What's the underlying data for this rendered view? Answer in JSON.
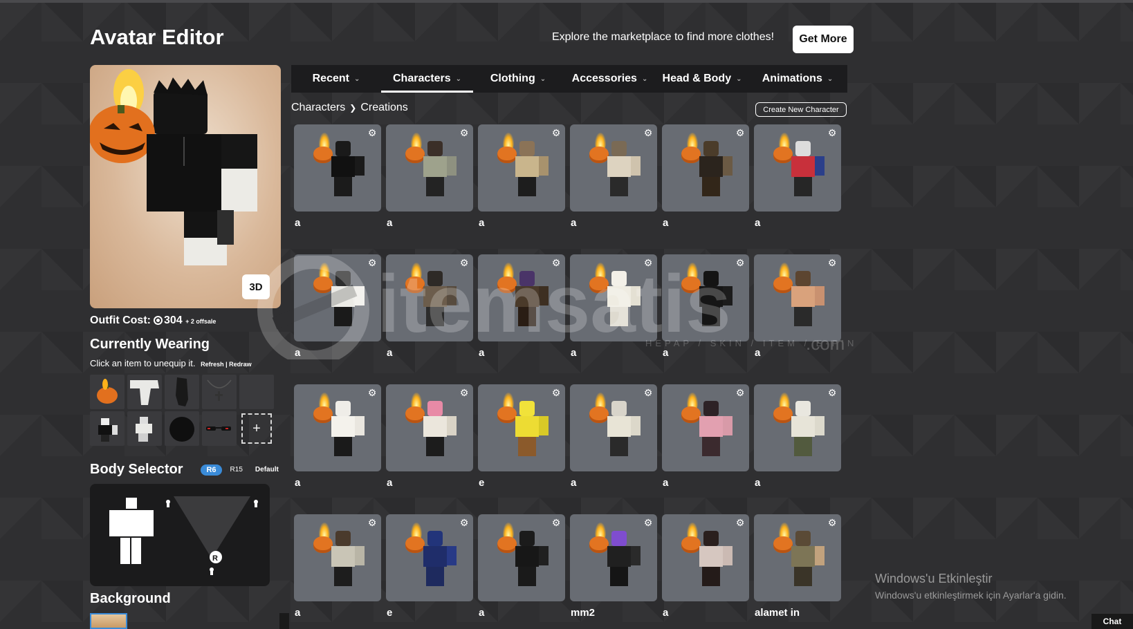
{
  "header": {
    "title": "Avatar Editor",
    "promo_text": "Explore the marketplace to find more clothes!",
    "get_more_label": "Get More"
  },
  "preview": {
    "view_3d_label": "3D",
    "outfit_cost_label": "Outfit Cost:",
    "outfit_cost_value": "304",
    "outfit_cost_extra": "+ 2 offsale"
  },
  "currently_wearing": {
    "heading": "Currently Wearing",
    "hint": "Click an item to unequip it.",
    "refresh_redraw": "Refresh | Redraw",
    "add_label": "+"
  },
  "body_selector": {
    "heading": "Body Selector",
    "options": [
      "R6",
      "R15",
      "Default"
    ],
    "selected": "R6"
  },
  "background_section": {
    "heading": "Background"
  },
  "tabs": [
    {
      "label": "Recent",
      "active": false
    },
    {
      "label": "Characters",
      "active": true
    },
    {
      "label": "Clothing",
      "active": false
    },
    {
      "label": "Accessories",
      "active": false
    },
    {
      "label": "Head & Body",
      "active": false
    },
    {
      "label": "Animations",
      "active": false
    }
  ],
  "breadcrumb": {
    "parent": "Characters",
    "current": "Creations"
  },
  "create_new_label": "Create New Character",
  "characters": [
    {
      "name": "a",
      "head": "#1a1a1a",
      "torso": "#111111",
      "arm": "#1a1a1a",
      "legs": "#1b1b1b"
    },
    {
      "name": "a",
      "head": "#3b2f28",
      "torso": "#9ea28c",
      "arm": "#8e9180",
      "legs": "#232323"
    },
    {
      "name": "a",
      "head": "#8b7357",
      "torso": "#c9b58c",
      "arm": "#a8926d",
      "legs": "#1d1d1d"
    },
    {
      "name": "a",
      "head": "#7a6a55",
      "torso": "#ddd3c0",
      "arm": "#cfc3ad",
      "legs": "#2a2a2a"
    },
    {
      "name": "a",
      "head": "#4b3c2a",
      "torso": "#2b241d",
      "arm": "#6b5a44",
      "legs": "#322619"
    },
    {
      "name": "a",
      "head": "#dcdcdc",
      "torso": "#c8303b",
      "arm": "#2b3f8a",
      "legs": "#262626"
    },
    {
      "name": "a",
      "head": "#2d2d2d",
      "torso": "#ecebe6",
      "arm": "#f0efea",
      "legs": "#1a1a1a"
    },
    {
      "name": "a",
      "head": "#2e2a26",
      "torso": "#6c5d4c",
      "arm": "#574b3e",
      "legs": "#2c2c2c"
    },
    {
      "name": "a",
      "head": "#4a3468",
      "torso": "#4a3a2a",
      "arm": "#3d2f22",
      "legs": "#2a1d14"
    },
    {
      "name": "a",
      "head": "#f3f0e8",
      "torso": "#efece2",
      "arm": "#e4e0d3",
      "legs": "#dedacf"
    },
    {
      "name": "a",
      "head": "#141414",
      "torso": "#161616",
      "arm": "#1c1c1c",
      "legs": "#151515"
    },
    {
      "name": "a",
      "head": "#5c4530",
      "torso": "#d9a27c",
      "arm": "#c99170",
      "legs": "#2a2a2a"
    },
    {
      "name": "a",
      "head": "#efede8",
      "torso": "#f4f2ec",
      "arm": "#e9e6df",
      "legs": "#1a1a1a"
    },
    {
      "name": "a",
      "head": "#e88aa6",
      "torso": "#ebe6dc",
      "arm": "#d9d3c6",
      "legs": "#1c1c1c"
    },
    {
      "name": "e",
      "head": "#f1e23a",
      "torso": "#eddc33",
      "arm": "#d8c926",
      "legs": "#8b5a2b"
    },
    {
      "name": "a",
      "head": "#d8d4ca",
      "torso": "#e8e4d6",
      "arm": "#dcd8ca",
      "legs": "#2a2a2a"
    },
    {
      "name": "a",
      "head": "#2d2226",
      "torso": "#e2a0b0",
      "arm": "#d89aa8",
      "legs": "#3b2a2e"
    },
    {
      "name": "a",
      "head": "#e9e7df",
      "torso": "#e7e4d8",
      "arm": "#dcd9cc",
      "legs": "#525a3e"
    },
    {
      "name": "a",
      "head": "#4a3a2c",
      "torso": "#c9c5b6",
      "arm": "#b9b5a6",
      "legs": "#1d1d1d"
    },
    {
      "name": "e",
      "head": "#22347a",
      "torso": "#1f2d6a",
      "arm": "#283a86",
      "legs": "#1e2a5e"
    },
    {
      "name": "a",
      "head": "#1b1b1b",
      "torso": "#171717",
      "arm": "#202020",
      "legs": "#1a1a1a"
    },
    {
      "name": "mm2",
      "head": "#7f4dcf",
      "torso": "#202020",
      "arm": "#2a2a2a",
      "legs": "#151515"
    },
    {
      "name": "a",
      "head": "#2a1f1d",
      "torso": "#d6c7c0",
      "arm": "#cbbab3",
      "legs": "#241b19"
    },
    {
      "name": "alamet in",
      "head": "#5a4a36",
      "torso": "#7d7556",
      "arm": "#c2a27d",
      "legs": "#3a3428"
    }
  ],
  "watermark": {
    "brand": "itemsatis",
    "tagline": "HEPAP / SKIN / ITEM / E-PIN",
    "domain": ".com"
  },
  "os_overlay": {
    "activate_title": "Windows'u Etkinleştir",
    "activate_hint": "Windows'u etkinleştirmek için Ayarlar'a gidin.",
    "chat_label": "Chat"
  }
}
